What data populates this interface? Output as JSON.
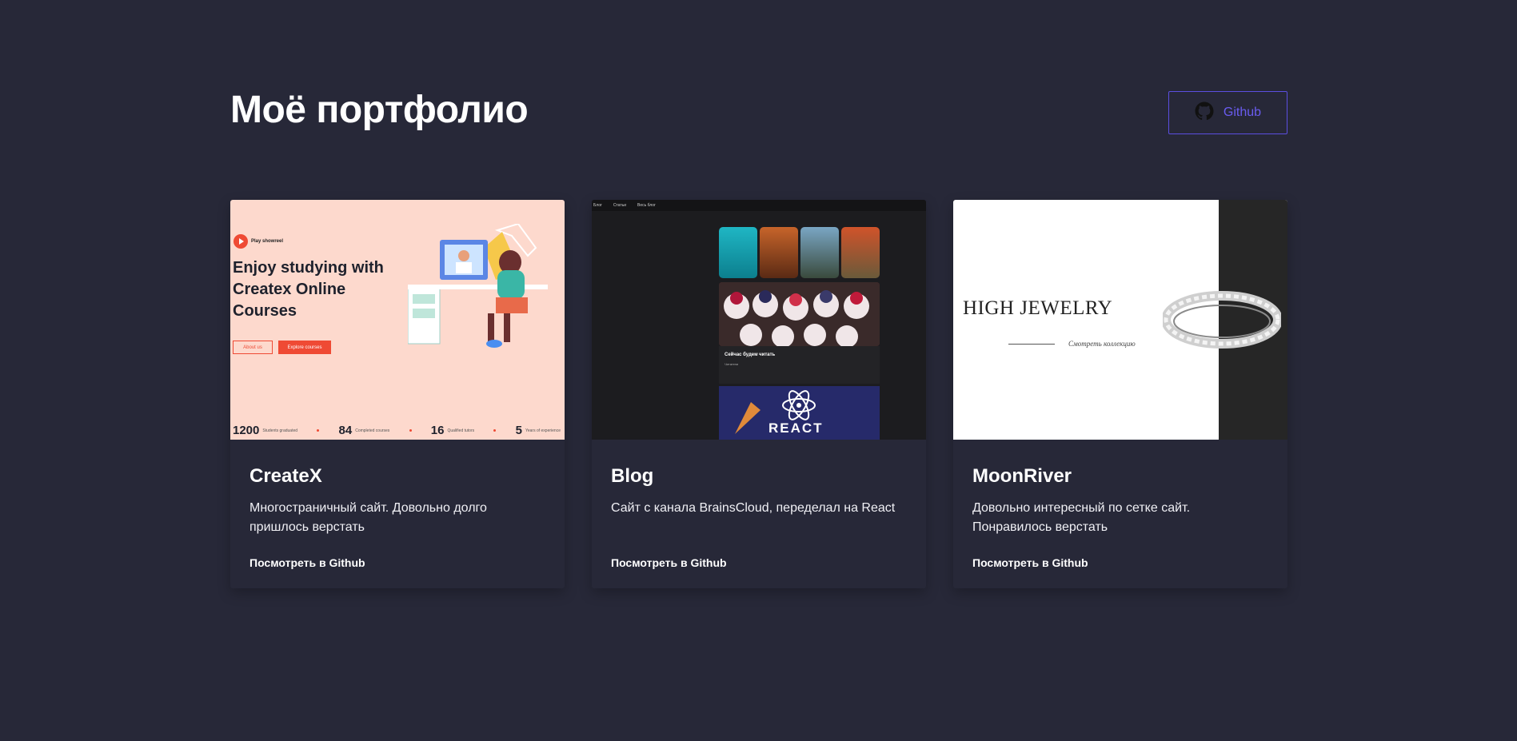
{
  "header": {
    "title": "Моё портфолио",
    "github_button_label": "Github"
  },
  "projects": [
    {
      "title": "CreateX",
      "description": "Многостраничный сайт. Довольно долго пришлось верстать",
      "link_label": "Посмотреть в Github",
      "preview": {
        "play_label": "Play showreel",
        "hero_text": "Enjoy studying with Createx Online Courses",
        "button_about": "About us",
        "button_explore": "Explore courses",
        "stats": [
          {
            "value": "1200",
            "label": "Students graduated"
          },
          {
            "value": "84",
            "label": "Completed courses"
          },
          {
            "value": "16",
            "label": "Qualified tutors"
          },
          {
            "value": "5",
            "label": "Years of experience"
          }
        ]
      }
    },
    {
      "title": "Blog",
      "description": "Сайт с канала BrainsCloud, переделал на React",
      "link_label": "Посмотреть в Github",
      "preview": {
        "nav_items": [
          "Блог",
          "Статьи",
          "Весь блог"
        ],
        "post_title": "Сейчас будем читать",
        "post_subtitle": "Читатели",
        "react_word": "REACT"
      }
    },
    {
      "title": "MoonRiver",
      "description": "Довольно интересный по сетке сайт. Понравилось верстать",
      "link_label": "Посмотреть в Github",
      "preview": {
        "headline": "HIGH JEWELRY",
        "subline": "Смотреть коллекцию"
      }
    }
  ],
  "colors": {
    "background": "#272838",
    "accent": "#5b4ee0",
    "createx_red": "#ef4a34"
  }
}
